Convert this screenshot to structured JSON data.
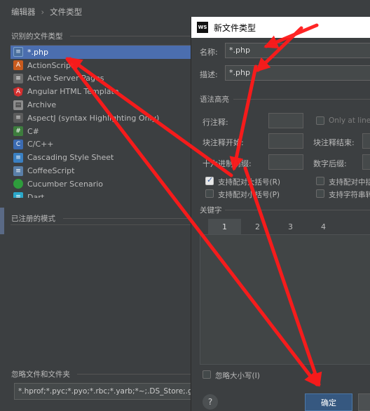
{
  "breadcrumb": {
    "parent": "编辑器",
    "separator": "›",
    "current": "文件类型"
  },
  "left": {
    "recognized_label": "识别的文件类型",
    "file_types": [
      {
        "label": "*.php",
        "icon": "doc",
        "glyph": "≡",
        "selected": true
      },
      {
        "label": "ActionScript",
        "icon": "as",
        "glyph": "A"
      },
      {
        "label": "Active Server Pages",
        "icon": "sp",
        "glyph": "≡"
      },
      {
        "label": "Angular HTML Template",
        "icon": "ang",
        "glyph": "A"
      },
      {
        "label": "Archive",
        "icon": "arc",
        "glyph": "▤"
      },
      {
        "label": "AspectJ (syntax Highlighting Only)",
        "icon": "asp",
        "glyph": "≡"
      },
      {
        "label": "C#",
        "icon": "cs",
        "glyph": "#"
      },
      {
        "label": "C/C++",
        "icon": "c",
        "glyph": "C"
      },
      {
        "label": "Cascading Style Sheet",
        "icon": "css",
        "glyph": "≡"
      },
      {
        "label": "CoffeeScript",
        "icon": "coffee",
        "glyph": "≡"
      },
      {
        "label": "Cucumber Scenario",
        "icon": "cuc",
        "glyph": ""
      },
      {
        "label": "Dart",
        "icon": "dart",
        "glyph": "≡"
      }
    ],
    "registered_label": "已注册的模式",
    "ignore_label": "忽略文件和文件夹",
    "ignore_value": "*.hprof;*.pyc;*.pyo;*.rbc;*.yarb;*~;.DS_Store;.gi"
  },
  "dialog": {
    "title": "新文件类型",
    "title_icon": "WS",
    "name_label": "名称:",
    "name_value": "*.php",
    "desc_label": "描述:",
    "desc_value": "*.php",
    "syntax_label": "语法高亮",
    "line_comment_label": "行注释:",
    "only_at_line_label": "Only at line",
    "block_start_label": "块注释开始:",
    "block_end_label": "块注释结束:",
    "hex_prefix_label": "十六进制前缀:",
    "num_postfix_label": "数字后缀:",
    "paired_braces_label": "支持配对大括号(R)",
    "paired_braces_checked": true,
    "paired_parens_label": "支持配对小括号(P)",
    "paired_brackets_label": "支持配对中括",
    "string_escape_label": "支持字符串转",
    "keywords_label": "关键字",
    "tabs": [
      "1",
      "2",
      "3",
      "4"
    ],
    "ignore_case_label": "忽略大小写(I)",
    "help_glyph": "?",
    "ok_label": "确定"
  },
  "colors": {
    "arrow": "#ff1a1a",
    "selection": "#4b6eaf",
    "ok_button": "#365880"
  }
}
